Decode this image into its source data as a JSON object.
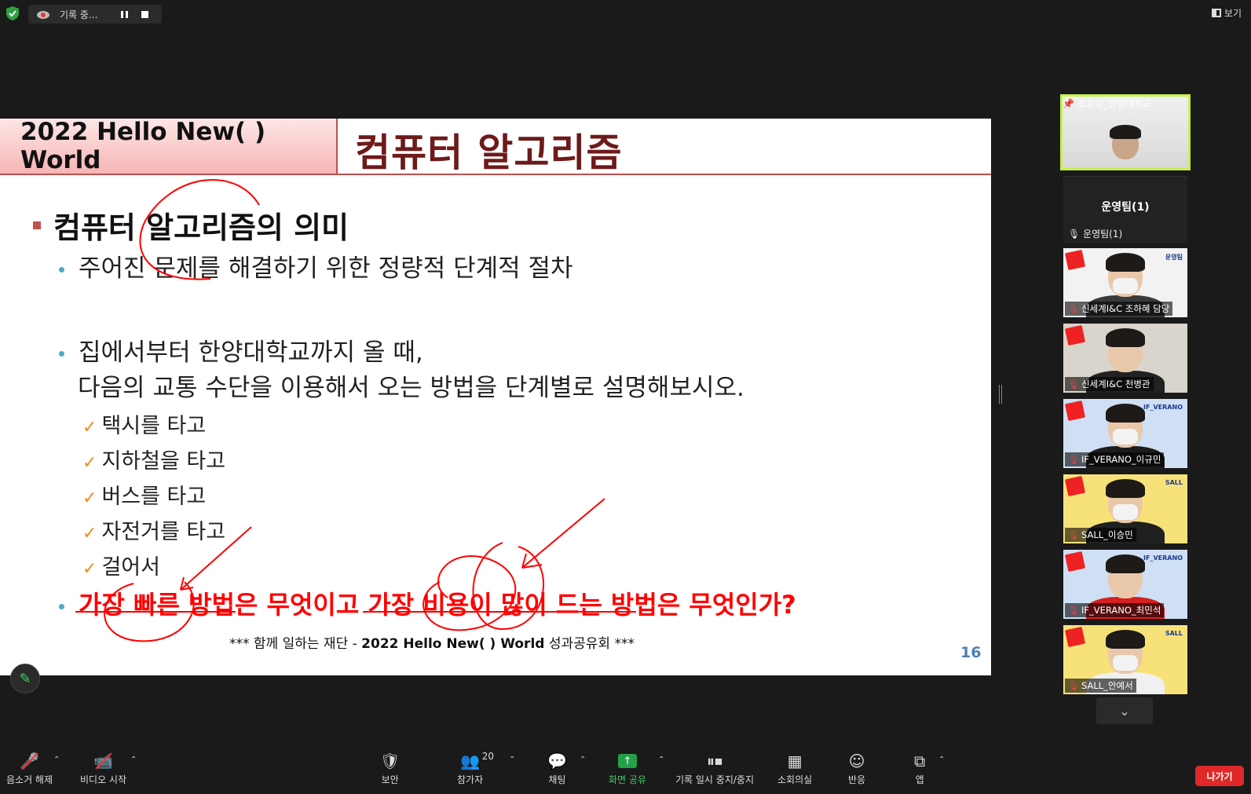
{
  "recording": {
    "status_label": "기록 중..."
  },
  "view_button": {
    "label": "보기"
  },
  "slide": {
    "header_left": "2022 Hello New( ) World",
    "title": "컴퓨터 알고리즘",
    "heading": "컴퓨터 알고리즘의 의미",
    "bullet1": "주어진 문제를 해결하기 위한 정량적 단계적 절차",
    "bullet2_line1": "집에서부터 한양대학교까지 올 때,",
    "bullet2_line2": "다음의 교통 수단을 이용해서 오는 방법을 단계별로 설명해보시오.",
    "checks": [
      "택시를 타고",
      "지하철을 타고",
      "버스를 타고",
      "자전거를 타고",
      "걸어서"
    ],
    "bullet3": "가장 빠른 방법은 무엇이고 가장 비용이 많이 드는 방법은 무엇인가?",
    "footer_prefix": "*** 함께 일하는 재단 -",
    "footer_bold": "2022 Hello New( ) World",
    "footer_suffix": "성과공유회 ***",
    "page_number": "16",
    "ink_color": "#ff0000"
  },
  "participants": {
    "pinned": {
      "name": "조호성_한양대학교"
    },
    "team_tile": {
      "title": "운영팀(1)",
      "name": "운영팀(1)"
    },
    "tiles": [
      {
        "name": "신세계I&C 조하혜 담당",
        "tag": "운영팀",
        "bg": "#f2f2f2",
        "shirt": "#3a3a3a",
        "mask": true
      },
      {
        "name": "신세계I&C 천병관",
        "tag": "",
        "bg": "#d9d4cc",
        "shirt": "#222222",
        "mask": false
      },
      {
        "name": "IF_VERANO_이규민",
        "tag": "IF_VERANO",
        "bg": "#cfe0f5",
        "shirt": "#1c1c1c",
        "mask": true
      },
      {
        "name": "SALL_이승민",
        "tag": "SALL",
        "bg": "#f7e27a",
        "shirt": "#202020",
        "mask": true
      },
      {
        "name": "IF_VERANO_최민석",
        "tag": "IF_VERANO",
        "bg": "#cfe0f5",
        "shirt": "#d42020",
        "mask": false
      },
      {
        "name": "SALL_안예서",
        "tag": "SALL",
        "bg": "#f7e27a",
        "shirt": "#f0f0f0",
        "mask": true
      }
    ]
  },
  "toolbar": {
    "unmute": "음소거 해제",
    "video": "비디오 시작",
    "security": "보안",
    "participants": "참가자",
    "participants_count": "20",
    "chat": "채팅",
    "share": "화면 공유",
    "record_pause": "기록 일시 중지/중지",
    "breakout": "소회의실",
    "reactions": "반응",
    "apps": "앱",
    "leave": "나가기"
  },
  "colors": {
    "accent_green": "#24a148",
    "leave_red": "#e02828",
    "pinned_border": "#c6f04a"
  }
}
